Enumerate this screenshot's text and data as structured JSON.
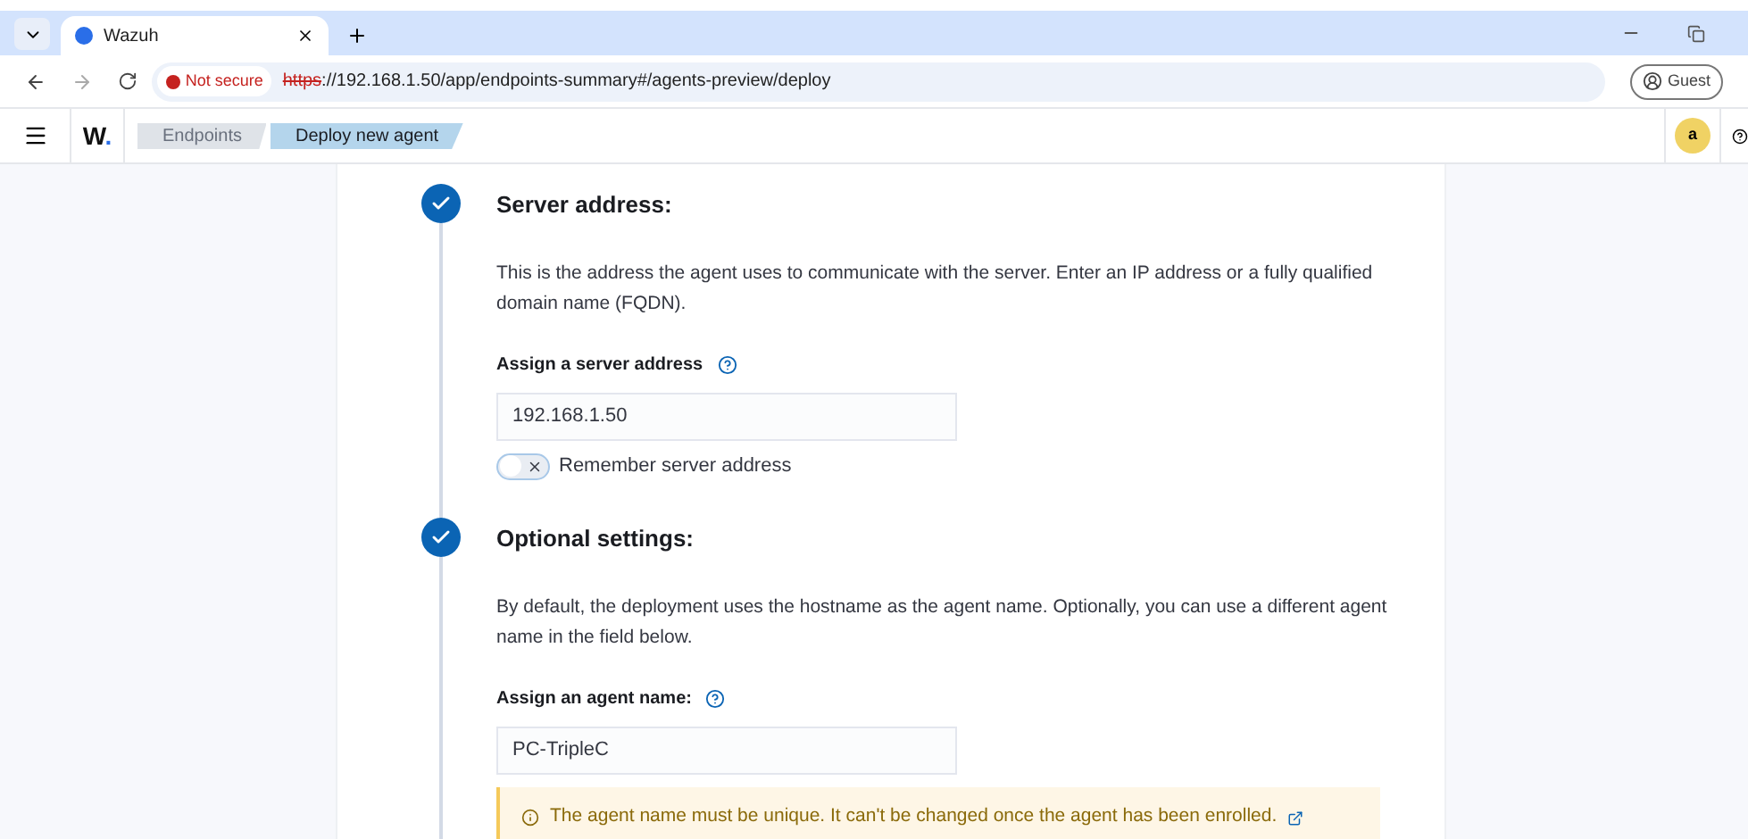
{
  "browser": {
    "tab_title": "Wazuh",
    "security": "Not secure",
    "url_scheme": "https",
    "url_rest": "://192.168.1.50/app/endpoints-summary#/agents-preview/deploy",
    "profile": "Guest"
  },
  "app_header": {
    "logo": "W",
    "logo_dot": ".",
    "breadcrumbs": [
      {
        "label": "Endpoints",
        "selected": false
      },
      {
        "label": "Deploy new agent",
        "selected": true
      }
    ],
    "avatar": "a"
  },
  "steps": [
    {
      "kind": "toggle",
      "done": true,
      "title": "Server address:",
      "description": "This is the address the agent uses to communicate with the server. Enter an IP address or a fully qualified domain name (FQDN).",
      "field_label": "Assign a server address",
      "value": "192.168.1.50",
      "toggle": {
        "label": "Remember server address",
        "on": false
      }
    },
    {
      "kind": "callout",
      "done": true,
      "title": "Optional settings:",
      "description": "By default, the deployment uses the hostname as the agent name. Optionally, you can use a different agent name in the field below.",
      "field_label": "Assign an agent name:",
      "value": "PC-TripleC",
      "callout": "The agent name must be unique. It can't be changed once the agent has been enrolled."
    }
  ]
}
